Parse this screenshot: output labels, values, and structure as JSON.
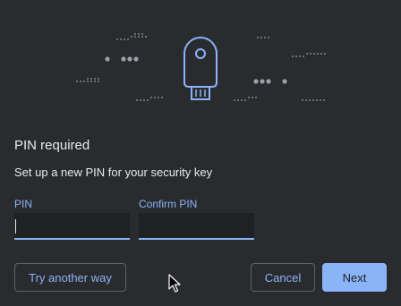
{
  "dialog": {
    "title": "PIN required",
    "subtitle": "Set up a new PIN for your security key"
  },
  "fields": {
    "pin": {
      "label": "PIN",
      "value": ""
    },
    "confirm": {
      "label": "Confirm PIN",
      "value": ""
    }
  },
  "buttons": {
    "try_another_way": "Try another way",
    "cancel": "Cancel",
    "next": "Next"
  },
  "icons": {
    "hero": "security-key-illustration",
    "cursor": "mouse-pointer-icon"
  },
  "colors": {
    "background": "#2a2b2e",
    "accent": "#8ab4f8",
    "text": "#e8eaed",
    "field_bg": "#202124",
    "border": "#5f6368"
  }
}
